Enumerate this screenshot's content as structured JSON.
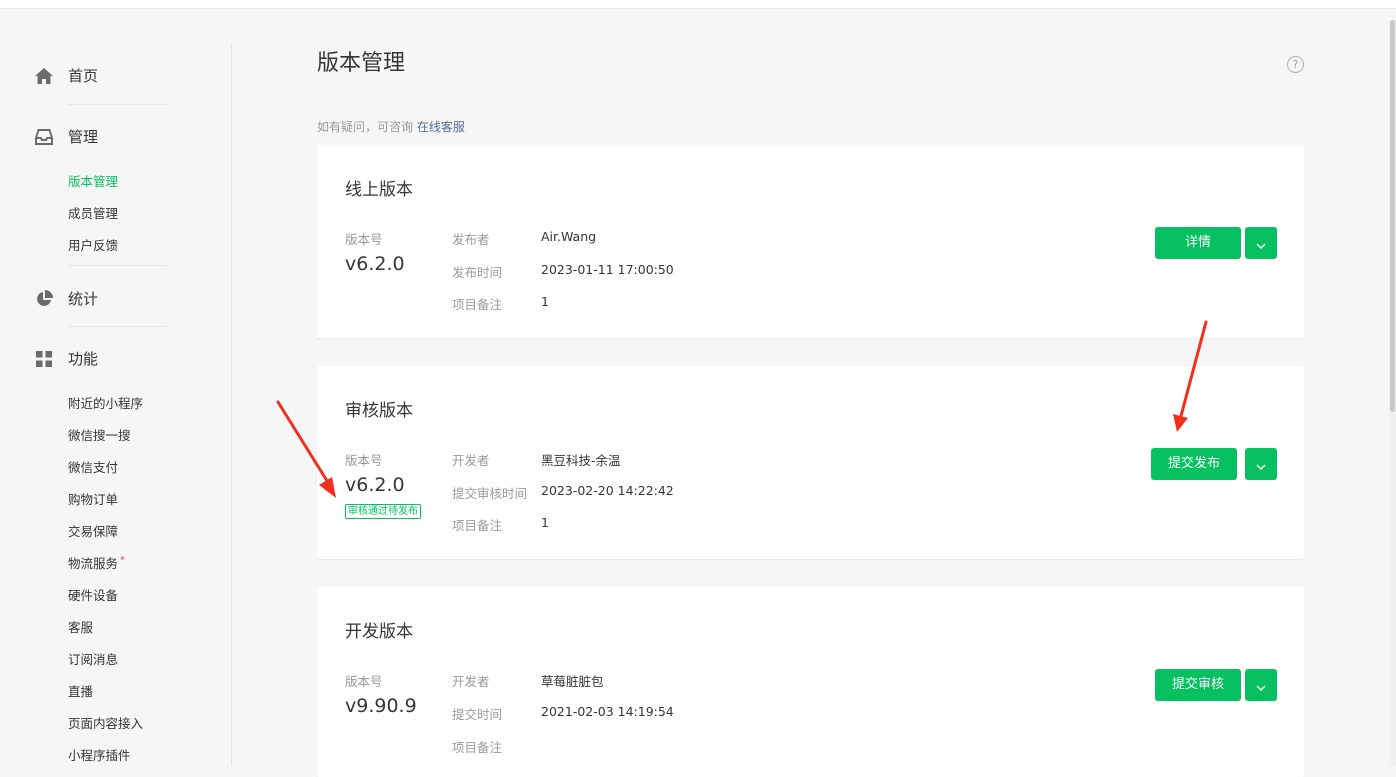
{
  "sidebar": {
    "home_label": "首页",
    "manage_label": "管理",
    "manage_items": [
      "版本管理",
      "成员管理",
      "用户反馈"
    ],
    "stats_label": "统计",
    "features_label": "功能",
    "feature_items": [
      "附近的小程序",
      "微信搜一搜",
      "微信支付",
      "购物订单",
      "交易保障",
      "物流服务",
      "硬件设备",
      "客服",
      "订阅消息",
      "直播",
      "页面内容接入",
      "小程序插件"
    ],
    "new_dot": "*"
  },
  "main": {
    "title": "版本管理",
    "help_icon": "?",
    "tip_text": "如有疑问，可咨询 ",
    "tip_link": "在线客服"
  },
  "cards": {
    "online": {
      "title": "线上版本",
      "version_label": "版本号",
      "version": "v6.2.0",
      "fields": [
        {
          "label": "发布者",
          "value": "Air.Wang"
        },
        {
          "label": "发布时间",
          "value": "2023-01-11 17:00:50"
        },
        {
          "label": "项目备注",
          "value": "1"
        }
      ],
      "button": "详情"
    },
    "review": {
      "title": "审核版本",
      "version_label": "版本号",
      "version": "v6.2.0",
      "status_badge": "审核通过待发布",
      "fields": [
        {
          "label": "开发者",
          "value": "黑豆科技-余温"
        },
        {
          "label": "提交审核时间",
          "value": "2023-02-20 14:22:42"
        },
        {
          "label": "项目备注",
          "value": "1"
        }
      ],
      "button": "提交发布"
    },
    "dev": {
      "title": "开发版本",
      "version_label": "版本号",
      "version": "v9.90.9",
      "fields": [
        {
          "label": "开发者",
          "value": "草莓脏脏包"
        },
        {
          "label": "提交时间",
          "value": "2021-02-03 14:19:54"
        },
        {
          "label": "项目备注",
          "value": ""
        }
      ],
      "button": "提交审核"
    }
  },
  "colors": {
    "accent": "#07c160",
    "link": "#576b95",
    "annotation_arrow": "#f22f1d"
  }
}
